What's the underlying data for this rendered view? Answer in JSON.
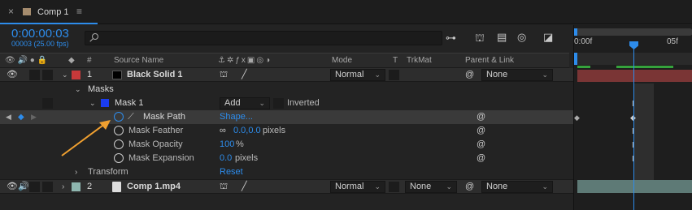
{
  "tab": {
    "title": "Comp 1"
  },
  "toolbar": {
    "timecode": "0:00:00:03",
    "frame_info": "00003 (25.00 fps)",
    "search_placeholder": ""
  },
  "columns": {
    "hash": "#",
    "source_name": "Source Name",
    "mode": "Mode",
    "t": "T",
    "trkmat": "TrkMat",
    "parent": "Parent & Link"
  },
  "timeline": {
    "ruler_start": "0:00f",
    "ruler_mark": "05f",
    "colors": {
      "playhead": "#2d8ceb",
      "red_layer": "#7a3535",
      "video_layer": "#5e7a76",
      "workarea": "#35a23c"
    }
  },
  "layer1": {
    "index": "1",
    "name": "Black Solid 1",
    "mode": "Normal",
    "parent": "None",
    "label_color": "#c8393a"
  },
  "masks": {
    "label": "Masks"
  },
  "mask1": {
    "name": "Mask 1",
    "mode": "Add",
    "inverted_label": "Inverted",
    "color": "#1a3cf0"
  },
  "props": [
    {
      "name": "Mask Path",
      "value": "Shape..."
    },
    {
      "name": "Mask Feather",
      "value": "0.0,0.0",
      "unit": "pixels"
    },
    {
      "name": "Mask Opacity",
      "value": "100",
      "unit": "%"
    },
    {
      "name": "Mask Expansion",
      "value": "0.0",
      "unit": "pixels"
    }
  ],
  "transform": {
    "label": "Transform",
    "value": "Reset"
  },
  "layer2": {
    "index": "2",
    "name": "Comp 1.mp4",
    "mode": "Normal",
    "trkmat": "None",
    "parent": "None",
    "label_color": "#8fb7b0"
  }
}
